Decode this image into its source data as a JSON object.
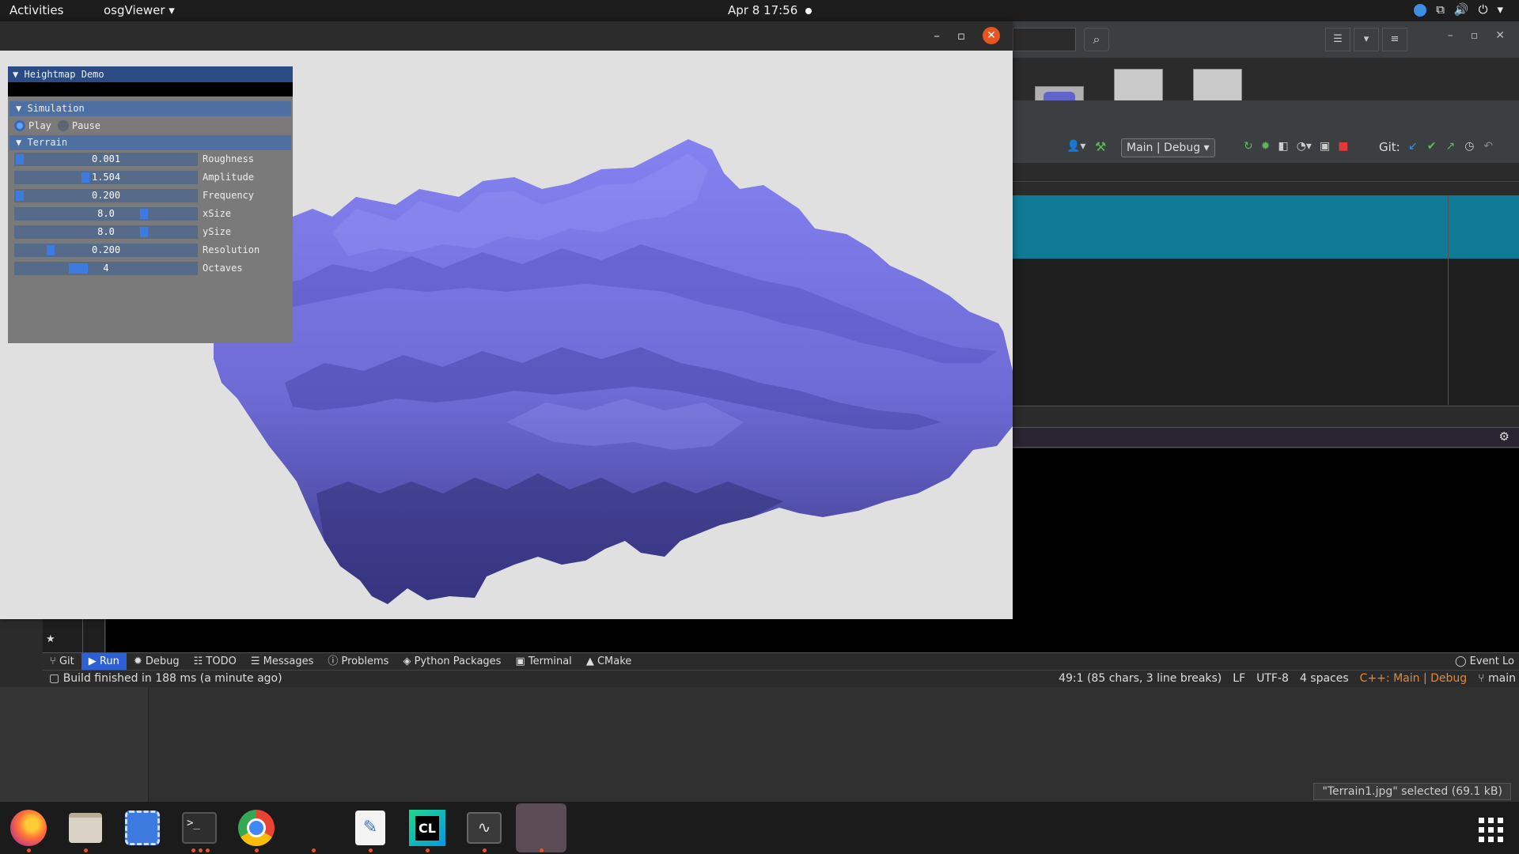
{
  "topbar": {
    "activities": "Activities",
    "app_menu": "osgViewer",
    "clock": "Apr 8  17:56"
  },
  "osg_window": {
    "panel": {
      "title": "Heightmap Demo",
      "simulation_header": "Simulation",
      "play_label": "Play",
      "pause_label": "Pause",
      "terrain_header": "Terrain",
      "sliders": [
        {
          "label": "Roughness",
          "value": "0.001",
          "level": 0.0
        },
        {
          "label": "Amplitude",
          "value": "1.504",
          "level": 0.38
        },
        {
          "label": "Frequency",
          "value": "0.200",
          "level": 0.0
        },
        {
          "label": "xSize",
          "value": "8.0",
          "level": 0.72
        },
        {
          "label": "ySize",
          "value": "8.0",
          "level": 0.72
        },
        {
          "label": "Resolution",
          "value": "0.200",
          "level": 0.18
        },
        {
          "label": "Octaves",
          "value": "4",
          "level": 0.33
        }
      ]
    },
    "terrain_color": "#7a78e8"
  },
  "clion": {
    "run_config": "Main | Debug",
    "git_label": "Git:",
    "tool_windows": [
      "Git",
      "Run",
      "Debug",
      "TODO",
      "Messages",
      "Problems",
      "Python Packages",
      "Terminal",
      "CMake"
    ],
    "event_log": "Event Lo",
    "status_left": "Build finished in 188 ms (a minute ago)",
    "status_right": {
      "position": "49:1 (85 chars, 3 line breaks)",
      "line_sep": "LF",
      "encoding": "UTF-8",
      "indent": "4 spaces",
      "context": "C++: Main | Debug",
      "branch": "main"
    }
  },
  "desktop": {
    "selection_info": "\"Terrain1.jpg\" selected  (69.1 kB)"
  },
  "dock": {
    "items": [
      "firefox-icon",
      "files-icon",
      "screenshot-icon",
      "terminal-icon",
      "chrome-icon",
      "text-editor-icon",
      "clion-icon",
      "system-monitor-icon",
      "osgviewer-icon"
    ],
    "accent": "#e95420"
  }
}
